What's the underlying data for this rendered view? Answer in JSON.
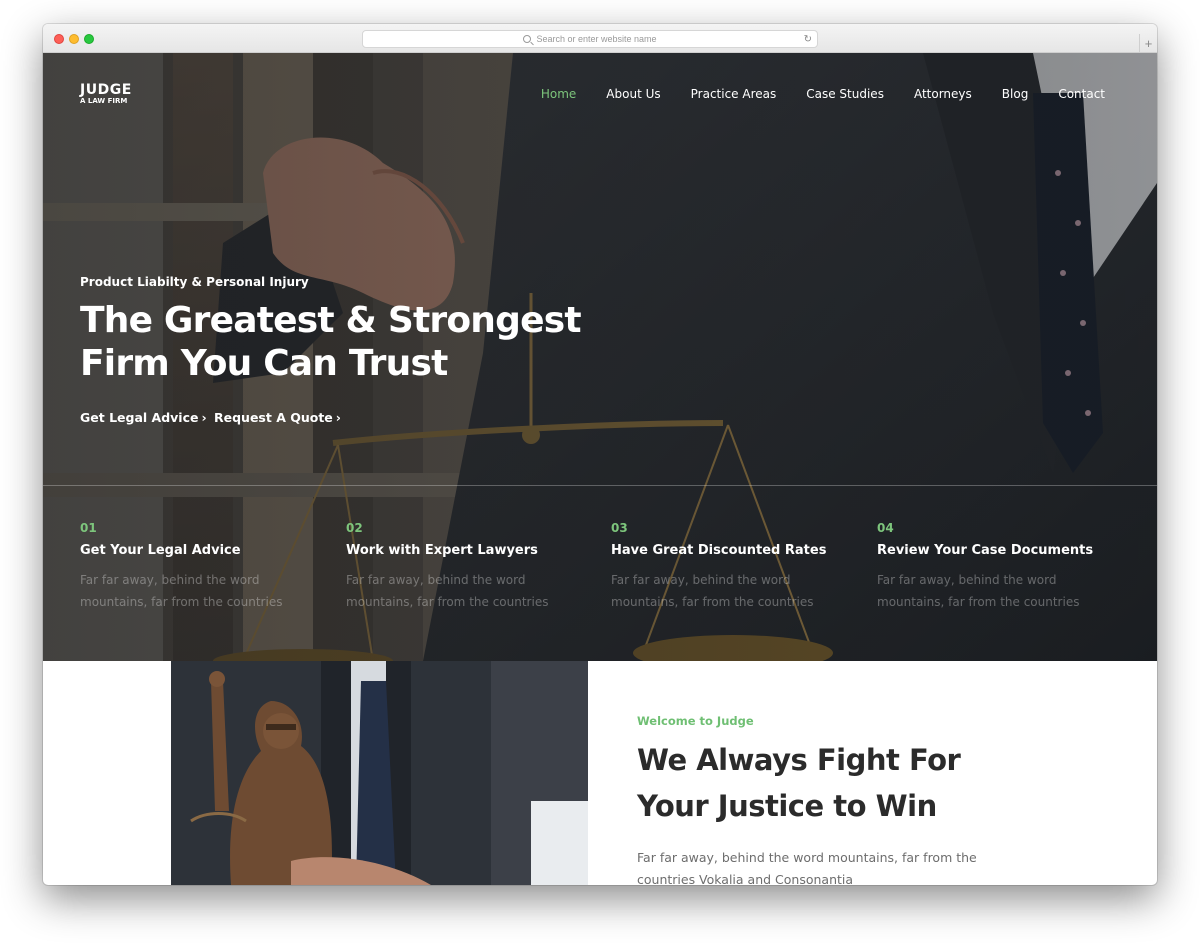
{
  "browser": {
    "url_placeholder": "Search or enter website name",
    "reload_glyph": "↻",
    "new_tab_glyph": "+"
  },
  "site": {
    "logo_line1": "JUDGE",
    "logo_line2": "A LAW FIRM"
  },
  "nav": {
    "items": [
      "Home",
      "About Us",
      "Practice Areas",
      "Case Studies",
      "Attorneys",
      "Blog",
      "Contact"
    ],
    "active_index": 0,
    "active_color": "#7dc57c"
  },
  "hero": {
    "kicker": "Product Liabilty & Personal Injury",
    "headline_line1": "The Greatest & Strongest",
    "headline_line2": "Firm You Can Trust",
    "cta1": "Get Legal Advice",
    "cta2": "Request A Quote",
    "chevron": "›"
  },
  "features": [
    {
      "num": "01",
      "title": "Get Your Legal Advice",
      "desc": "Far far away, behind the word mountains, far from the countries"
    },
    {
      "num": "02",
      "title": "Work with Expert Lawyers",
      "desc": "Far far away, behind the word mountains, far from the countries"
    },
    {
      "num": "03",
      "title": "Have Great Discounted Rates",
      "desc": "Far far away, behind the word mountains, far from the countries"
    },
    {
      "num": "04",
      "title": "Review Your Case Documents",
      "desc": "Far far away, behind the word mountains, far from the countries"
    }
  ],
  "about": {
    "eyebrow": "Welcome to Judge",
    "title_line1": "We Always Fight For",
    "title_line2": "Your Justice to Win",
    "desc": "Far far away, behind the word mountains, far from the countries Vokalia and Consonantia"
  },
  "colors": {
    "accent": "#7dc57c",
    "heading": "#2b2b2b"
  }
}
